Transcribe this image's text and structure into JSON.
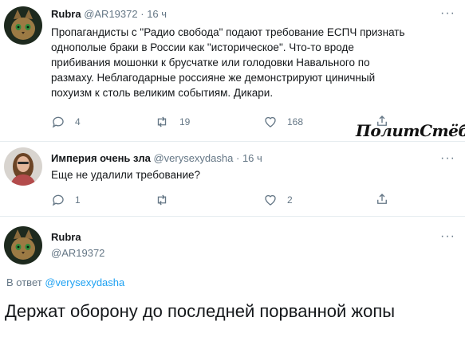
{
  "tweet1": {
    "display_name": "Rubra",
    "handle": "@AR19372",
    "separator": "·",
    "time": "16 ч",
    "more": "···",
    "text_lines": [
      "Пропагандисты с \"Радио свобода\" подают требование ЕСПЧ признать",
      "однополые браки в России как \"историческое\". Что-то вроде",
      "прибивания мошонки к брусчатке или голодовки Навального по",
      "размаху. Неблагодарные россияне же демонстрируют циничный",
      "похуизм к столь великим событиям. Дикари."
    ],
    "replies": "4",
    "retweets": "19",
    "likes": "168"
  },
  "watermark": "ПолитСтёб",
  "tweet2": {
    "display_name": "Империя очень зла",
    "handle": "@verysexydasha",
    "separator": "·",
    "time": "16 ч",
    "more": "···",
    "text": "Еще не удалили требование?",
    "replies": "1",
    "retweets": "",
    "likes": "2"
  },
  "tweet3": {
    "display_name": "Rubra",
    "handle": "@AR19372",
    "more": "···",
    "reply_prefix": "В ответ",
    "reply_to": "@verysexydasha",
    "text": "Держат оборону до последней порванной жопы"
  },
  "colors": {
    "text": "#14171a",
    "muted": "#657786",
    "link": "#1da1f2",
    "divider": "#e6ecf0"
  }
}
